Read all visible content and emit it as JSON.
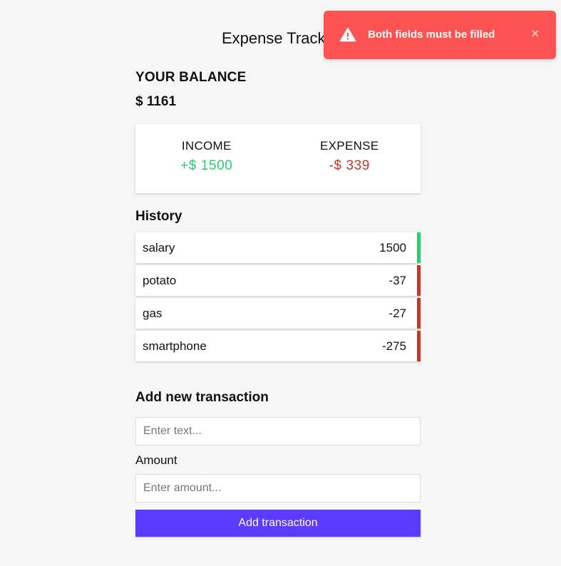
{
  "app": {
    "title": "Expense Tracker"
  },
  "balance": {
    "label": "YOUR BALANCE",
    "value": "$ 1161"
  },
  "summary": {
    "income_label": "INCOME",
    "income_value": "+$ 1500",
    "expense_label": "EXPENSE",
    "expense_value": "-$ 339"
  },
  "history": {
    "title": "History",
    "items": [
      {
        "text": "salary",
        "amount": "1500",
        "type": "plus"
      },
      {
        "text": "potato",
        "amount": "-37",
        "type": "minus"
      },
      {
        "text": "gas",
        "amount": "-27",
        "type": "minus"
      },
      {
        "text": "smartphone",
        "amount": "-275",
        "type": "minus"
      }
    ]
  },
  "form": {
    "title": "Add new transaction",
    "text_placeholder": "Enter text...",
    "text_value": "",
    "amount_label": "Amount",
    "amount_placeholder": "Enter amount...",
    "amount_value": "",
    "submit_label": "Add transaction"
  },
  "toast": {
    "message": "Both fields must be filled",
    "close_symbol": "×",
    "icon": "warning-icon",
    "color": "#fd5353"
  },
  "colors": {
    "income": "#2ecc71",
    "expense": "#c0392b",
    "button": "#5b3cff",
    "background": "#f6f6f6"
  }
}
